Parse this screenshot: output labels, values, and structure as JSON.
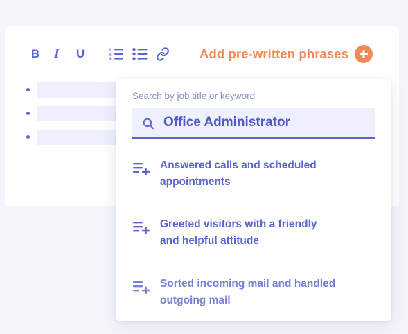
{
  "toolbar": {
    "bold_label": "B",
    "italic_label": "I",
    "underline_label": "U",
    "ordered_list_icon": "ordered-list-icon",
    "bullet_list_icon": "bullet-list-icon",
    "link_icon": "link-icon",
    "add_phrases_label": "Add pre-written phrases",
    "add_phrases_icon": "plus-circle-icon"
  },
  "editor": {
    "bullet_count": 3
  },
  "dropdown": {
    "search_label": "Search by job title or keyword",
    "search_value": "Office Administrator",
    "suggestions": [
      {
        "line1": "Answered calls and scheduled",
        "line2": "appointments"
      },
      {
        "line1": "Greeted visitors with a friendly",
        "line2": "and helpful attitude"
      },
      {
        "line1": "Sorted incoming mail and handled",
        "line2": "outgoing mail"
      }
    ]
  },
  "colors": {
    "accent": "#5b65d1",
    "orange": "#f08a58",
    "field_bg": "#eef0fd",
    "page_bg": "#f4f5fb"
  }
}
